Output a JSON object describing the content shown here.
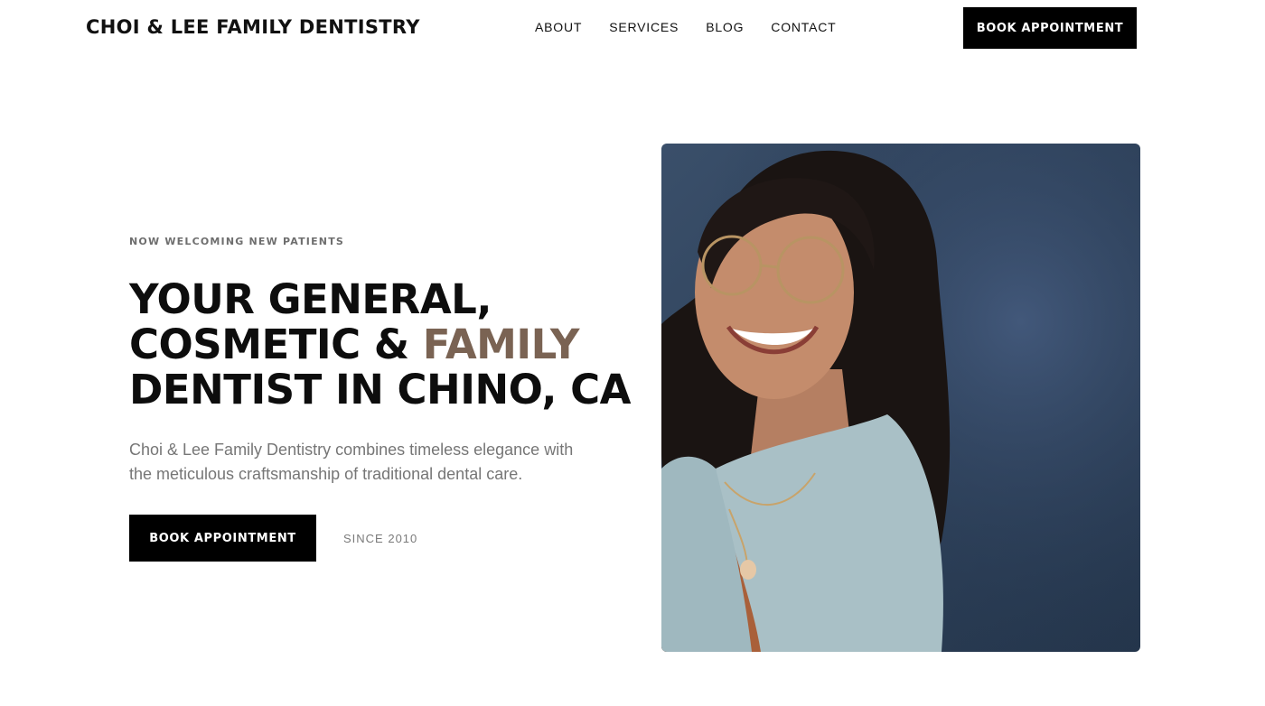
{
  "header": {
    "logo": "CHOI & LEE FAMILY DENTISTRY",
    "nav": [
      "ABOUT",
      "SERVICES",
      "BLOG",
      "CONTACT"
    ],
    "cta_label": "BOOK APPOINTMENT"
  },
  "hero": {
    "eyebrow": "NOW WELCOMING NEW PATIENTS",
    "headline": {
      "line1": "YOUR GENERAL,",
      "line2_prefix": "COSMETIC & ",
      "line2_accent": "FAMILY",
      "line3": "DENTIST IN CHINO, CA"
    },
    "description": "Choi & Lee Family Dentistry combines timeless elegance with the meticulous craftsmanship of traditional dental care.",
    "primary_cta": "BOOK APPOINTMENT",
    "since": "SINCE 2010"
  },
  "colors": {
    "accent": "#7a6353",
    "photo_background": "#2f4259",
    "button": "#000000"
  }
}
